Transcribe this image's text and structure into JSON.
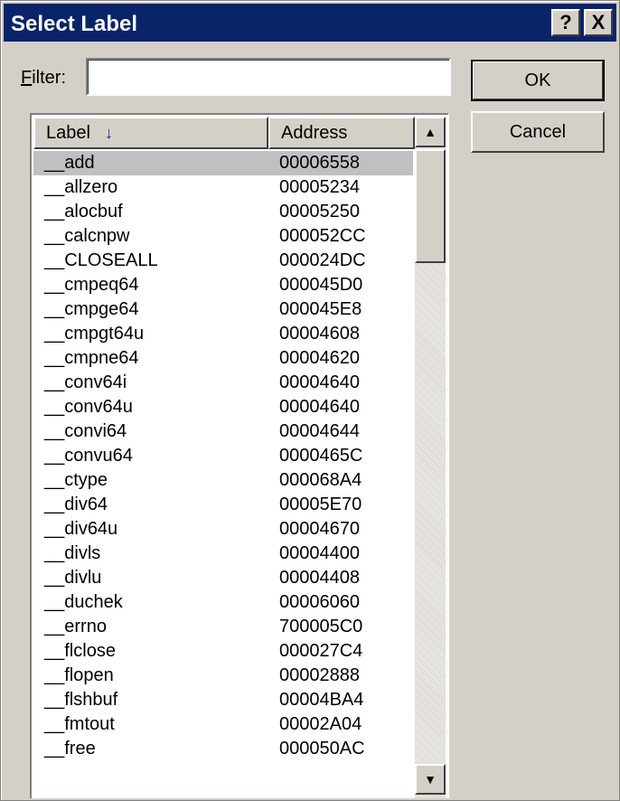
{
  "window": {
    "title": "Select Label",
    "help_glyph": "?",
    "close_glyph": "X"
  },
  "filter": {
    "label_prefix": "F",
    "label_rest": "ilter:",
    "value": "",
    "placeholder": ""
  },
  "buttons": {
    "ok": "OK",
    "cancel": "Cancel"
  },
  "list": {
    "columns": [
      {
        "label": "Label",
        "sort_glyph": "↓"
      },
      {
        "label": "Address"
      }
    ],
    "scroll": {
      "up_glyph": "▲",
      "down_glyph": "▼"
    },
    "rows": [
      {
        "label": "__add",
        "address": "00006558",
        "selected": true
      },
      {
        "label": "__allzero",
        "address": "00005234"
      },
      {
        "label": "__alocbuf",
        "address": "00005250"
      },
      {
        "label": "__calcnpw",
        "address": "000052CC"
      },
      {
        "label": "__CLOSEALL",
        "address": "000024DC"
      },
      {
        "label": "__cmpeq64",
        "address": "000045D0"
      },
      {
        "label": "__cmpge64",
        "address": "000045E8"
      },
      {
        "label": "__cmpgt64u",
        "address": "00004608"
      },
      {
        "label": "__cmpne64",
        "address": "00004620"
      },
      {
        "label": "__conv64i",
        "address": "00004640"
      },
      {
        "label": "__conv64u",
        "address": "00004640"
      },
      {
        "label": "__convi64",
        "address": "00004644"
      },
      {
        "label": "__convu64",
        "address": "0000465C"
      },
      {
        "label": "__ctype",
        "address": "000068A4"
      },
      {
        "label": "__div64",
        "address": "00005E70"
      },
      {
        "label": "__div64u",
        "address": "00004670"
      },
      {
        "label": "__divls",
        "address": "00004400"
      },
      {
        "label": "__divlu",
        "address": "00004408"
      },
      {
        "label": "__duchek",
        "address": "00006060"
      },
      {
        "label": "__errno",
        "address": "700005C0"
      },
      {
        "label": "__flclose",
        "address": "000027C4"
      },
      {
        "label": "__flopen",
        "address": "00002888"
      },
      {
        "label": "__flshbuf",
        "address": "00004BA4"
      },
      {
        "label": "__fmtout",
        "address": "00002A04"
      },
      {
        "label": "__free",
        "address": "000050AC"
      }
    ]
  },
  "colors": {
    "titlebar": "#0a246a",
    "face": "#d4d0c8",
    "selection": "#c0c0c0"
  }
}
